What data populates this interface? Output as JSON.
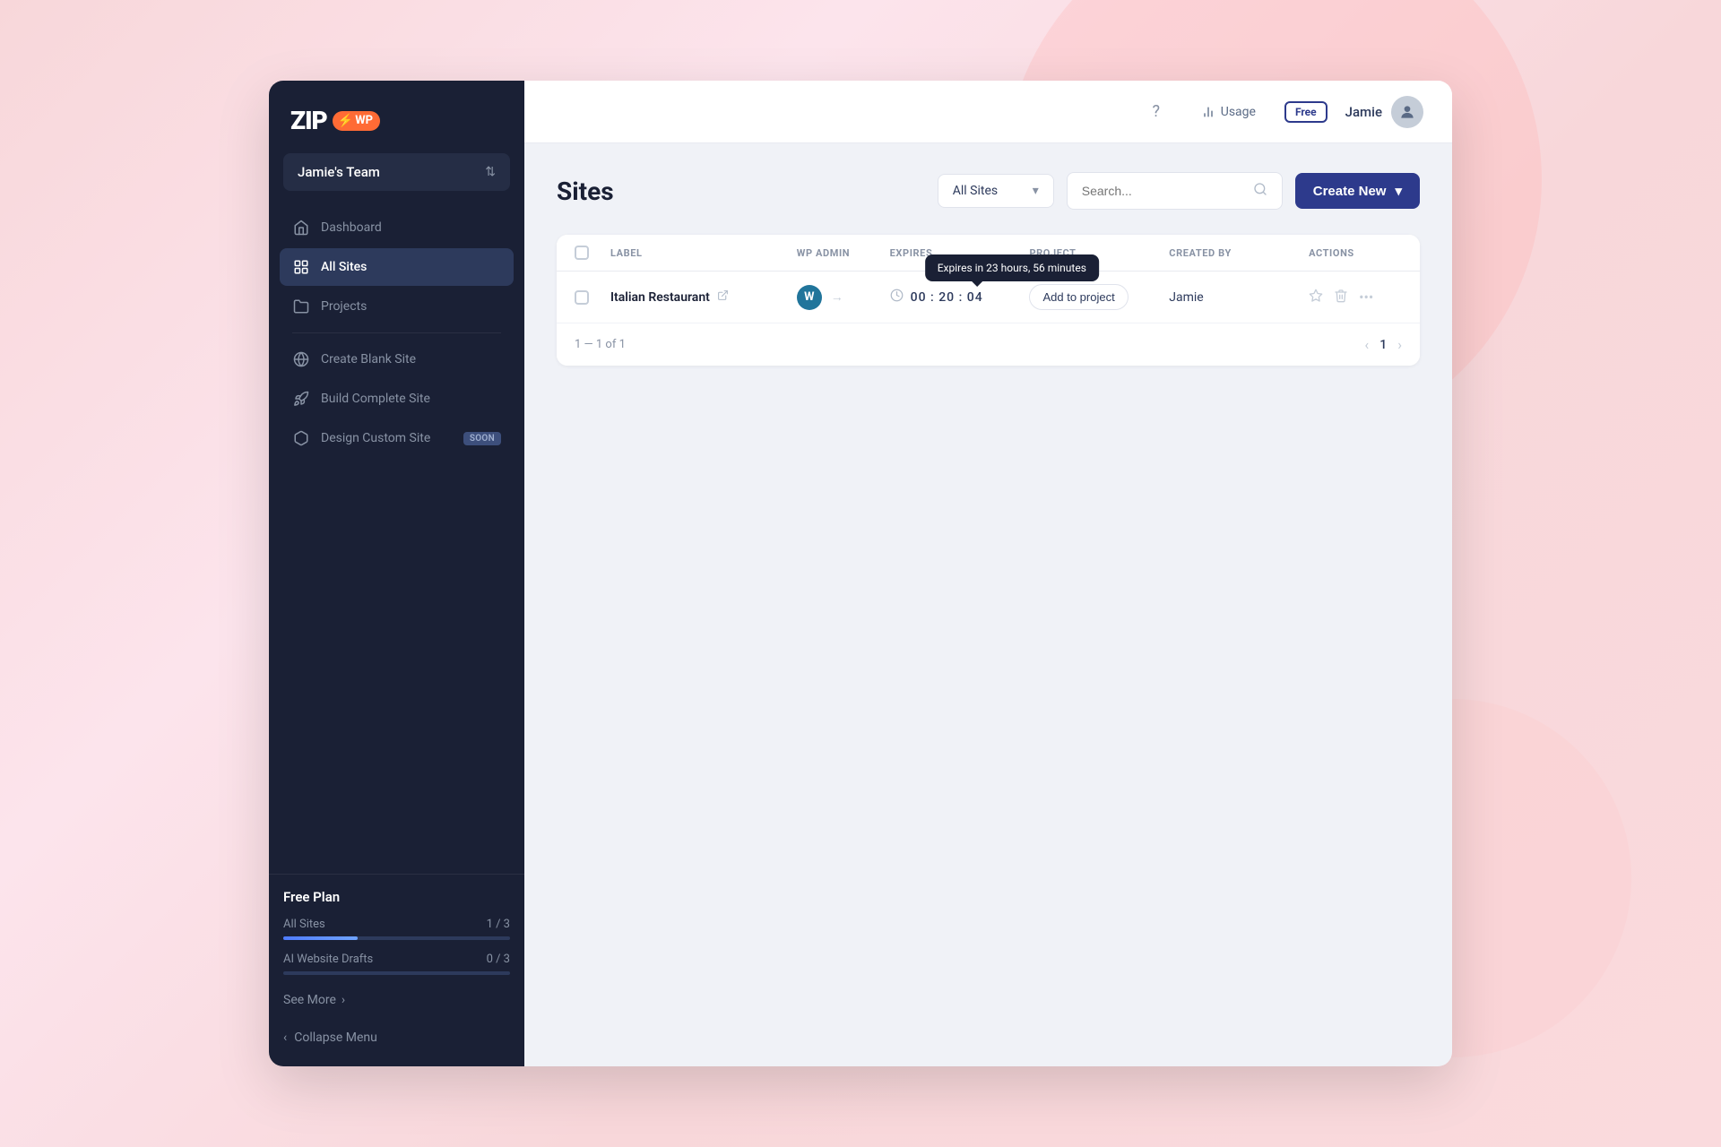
{
  "app": {
    "logo_zip": "ZIP",
    "logo_wp": "WP",
    "logo_lightning": "⚡"
  },
  "sidebar": {
    "team_name": "Jamie's Team",
    "nav_items": [
      {
        "id": "dashboard",
        "label": "Dashboard",
        "icon": "house",
        "active": false
      },
      {
        "id": "all-sites",
        "label": "All Sites",
        "icon": "grid",
        "active": true
      },
      {
        "id": "projects",
        "label": "Projects",
        "icon": "folder",
        "active": false
      }
    ],
    "create_items": [
      {
        "id": "create-blank",
        "label": "Create Blank Site",
        "icon": "wordpress",
        "soon": false
      },
      {
        "id": "build-complete",
        "label": "Build Complete Site",
        "icon": "rocket",
        "soon": false
      },
      {
        "id": "design-custom",
        "label": "Design Custom Site",
        "icon": "cube",
        "soon": true
      }
    ],
    "free_plan": {
      "title": "Free Plan",
      "all_sites_label": "All Sites",
      "all_sites_count": "1 / 3",
      "all_sites_pct": 33,
      "ai_drafts_label": "AI Website Drafts",
      "ai_drafts_count": "0 / 3",
      "ai_drafts_pct": 0,
      "see_more": "See More",
      "see_more_arrow": "›"
    },
    "collapse_label": "Collapse Menu",
    "collapse_arrow": "‹"
  },
  "header": {
    "help_icon": "?",
    "usage_icon": "chart",
    "usage_label": "Usage",
    "free_badge": "Free",
    "user_name": "Jamie",
    "user_avatar_icon": "👤"
  },
  "page": {
    "title": "Sites",
    "filter_dropdown": {
      "label": "All Sites",
      "arrow": "▾"
    },
    "search_placeholder": "Search...",
    "create_new_label": "Create New",
    "create_new_arrow": "▾"
  },
  "table": {
    "columns": [
      "",
      "LABEL",
      "WP ADMIN",
      "EXPIRES",
      "PROJECT",
      "CREATED BY",
      "ACTIONS"
    ],
    "rows": [
      {
        "id": "italian-restaurant",
        "name": "Italian Restaurant",
        "wp_admin": "WP",
        "expiry_time": "00 : 20 : 04",
        "project": "Add to project",
        "created_by": "Jamie",
        "tooltip": "Expires in 23 hours, 56 minutes"
      }
    ],
    "pagination": {
      "info": "1 — 1 of 1",
      "current_page": "1"
    }
  }
}
